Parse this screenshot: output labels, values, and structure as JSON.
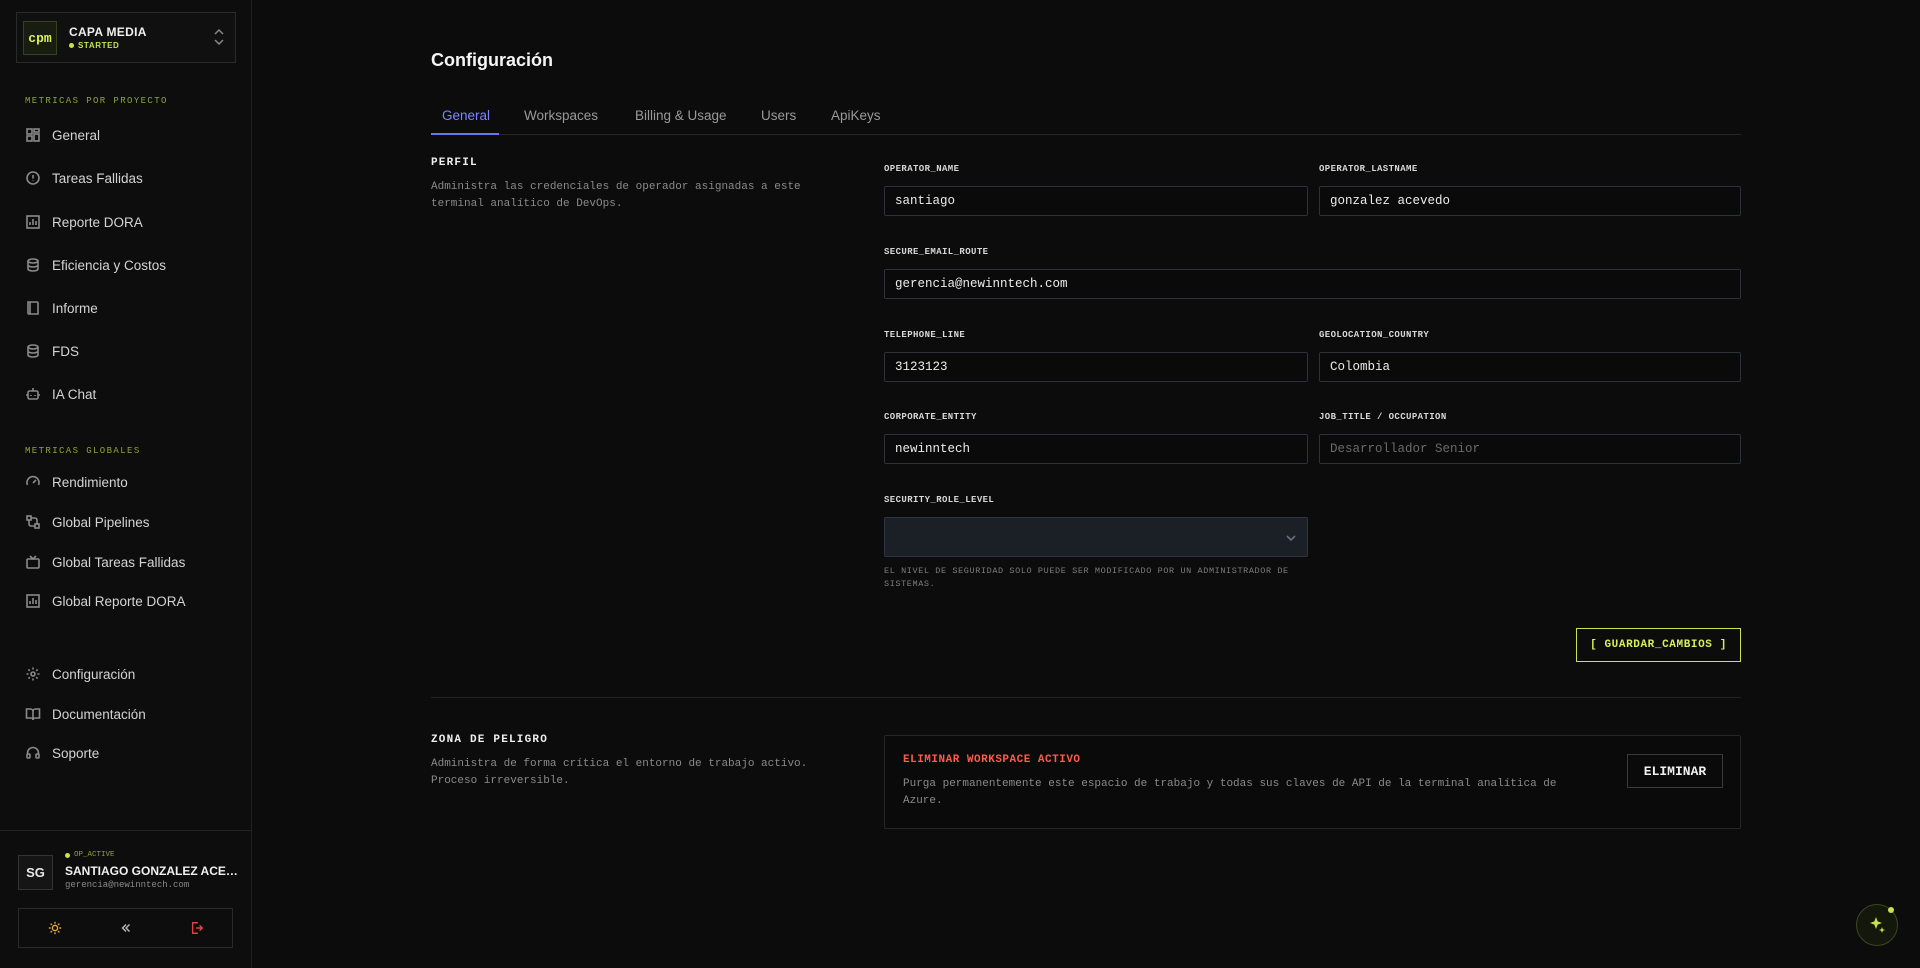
{
  "org": {
    "logo": "cpm",
    "name": "CAPA MEDIA",
    "status": "STARTED"
  },
  "sidebar": {
    "section_project": "METRICAS POR PROYECTO",
    "project_items": [
      {
        "label": "General",
        "icon": "dashboard-icon"
      },
      {
        "label": "Tareas Fallidas",
        "icon": "alert-circle-icon"
      },
      {
        "label": "Reporte DORA",
        "icon": "bar-chart-icon"
      },
      {
        "label": "Eficiencia y Costos",
        "icon": "database-icon"
      },
      {
        "label": "Informe",
        "icon": "book-icon"
      },
      {
        "label": "FDS",
        "icon": "database-icon"
      },
      {
        "label": "IA Chat",
        "icon": "bot-icon"
      }
    ],
    "section_global": "METRICAS GLOBALES",
    "global_items": [
      {
        "label": "Rendimiento",
        "icon": "gauge-icon"
      },
      {
        "label": "Global Pipelines",
        "icon": "workflow-icon"
      },
      {
        "label": "Global Tareas Fallidas",
        "icon": "tv-icon"
      },
      {
        "label": "Global Reporte DORA",
        "icon": "bar-chart-icon"
      }
    ],
    "bottom_items": [
      {
        "label": "Configuración",
        "icon": "gear-icon"
      },
      {
        "label": "Documentación",
        "icon": "open-book-icon"
      },
      {
        "label": "Soporte",
        "icon": "headset-icon"
      }
    ]
  },
  "user": {
    "initials": "SG",
    "status": "OP_ACTIVE",
    "name": "SANTIAGO GONZALEZ ACEVEDO",
    "email": "gerencia@newinntech.com"
  },
  "page": {
    "title": "Configuración"
  },
  "tabs": [
    {
      "label": "General",
      "active": true
    },
    {
      "label": "Workspaces"
    },
    {
      "label": "Billing & Usage"
    },
    {
      "label": "Users"
    },
    {
      "label": "ApiKeys"
    }
  ],
  "profile": {
    "title": "PERFIL",
    "description": "Administra las credenciales de operador asignadas a este terminal analítico de DevOps.",
    "fields": {
      "operator_name": {
        "label": "OPERATOR_NAME",
        "value": "santiago"
      },
      "operator_lastname": {
        "label": "OPERATOR_LASTNAME",
        "value": "gonzalez acevedo"
      },
      "email": {
        "label": "SECURE_EMAIL_ROUTE",
        "value": "gerencia@newinntech.com"
      },
      "phone": {
        "label": "TELEPHONE_LINE",
        "value": "3123123"
      },
      "country": {
        "label": "GEOLOCATION_COUNTRY",
        "value": "Colombia"
      },
      "company": {
        "label": "CORPORATE_ENTITY",
        "value": "newinntech"
      },
      "job": {
        "label": "JOB_TITLE / OCCUPATION",
        "value": "",
        "placeholder": "Desarrollador Senior"
      },
      "role": {
        "label": "SECURITY_ROLE_LEVEL",
        "value": "",
        "hint": "EL NIVEL DE SEGURIDAD SOLO PUEDE SER MODIFICADO POR UN ADMINISTRADOR DE SISTEMAS."
      }
    },
    "save_label": "[ GUARDAR_CAMBIOS ]"
  },
  "danger": {
    "title": "ZONA DE PELIGRO",
    "description": "Administra de forma crítica el entorno de trabajo activo. Proceso irreversible.",
    "card_title": "ELIMINAR WORKSPACE ACTIVO",
    "card_desc": "Purga permanentemente este espacio de trabajo y todas sus claves de API de la terminal analítica de Azure.",
    "button": "ELIMINAR"
  },
  "colors": {
    "accent": "#c8e44a",
    "tab_active": "#7a86ff",
    "danger": "#ff5a4a",
    "background": "#0c0c0c"
  }
}
